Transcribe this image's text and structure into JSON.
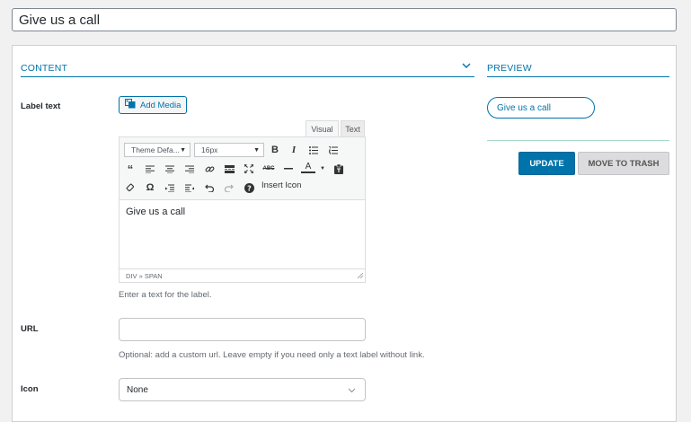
{
  "title": {
    "value": "Give us a call"
  },
  "content": {
    "heading": "CONTENT",
    "label_text": "Label text",
    "add_media": "Add Media",
    "tabs": {
      "visual": "Visual",
      "text": "Text"
    },
    "toolbar": {
      "format_select": "Theme Defa...",
      "size_select": "16px",
      "insert_icon": "Insert Icon",
      "icons": [
        "bold-icon",
        "italic-icon",
        "bullet-list-icon",
        "numbered-list-icon",
        "blockquote-icon",
        "align-left-icon",
        "align-center-icon",
        "align-right-icon",
        "link-icon",
        "read-more-icon",
        "fullscreen-icon",
        "strikethrough-icon",
        "horizontal-rule-icon",
        "text-color-icon",
        "paste-text-icon",
        "clear-formatting-icon",
        "special-character-icon",
        "outdent-icon",
        "indent-icon",
        "undo-icon",
        "redo-icon",
        "help-icon"
      ]
    },
    "editor_text": "Give us a call",
    "status_path": "DIV » SPAN",
    "label_help": "Enter a text for the label.",
    "url_label": "URL",
    "url_value": "",
    "url_help": "Optional: add a custom url. Leave empty if you need only a text label without link.",
    "icon_label": "Icon",
    "icon_value": "None"
  },
  "preview": {
    "heading": "PREVIEW",
    "pill_text": "Give us a call",
    "update": "UPDATE",
    "trash": "MOVE TO TRASH"
  },
  "colors": {
    "accent": "#0073aa",
    "divider": "#a7d7c5"
  }
}
